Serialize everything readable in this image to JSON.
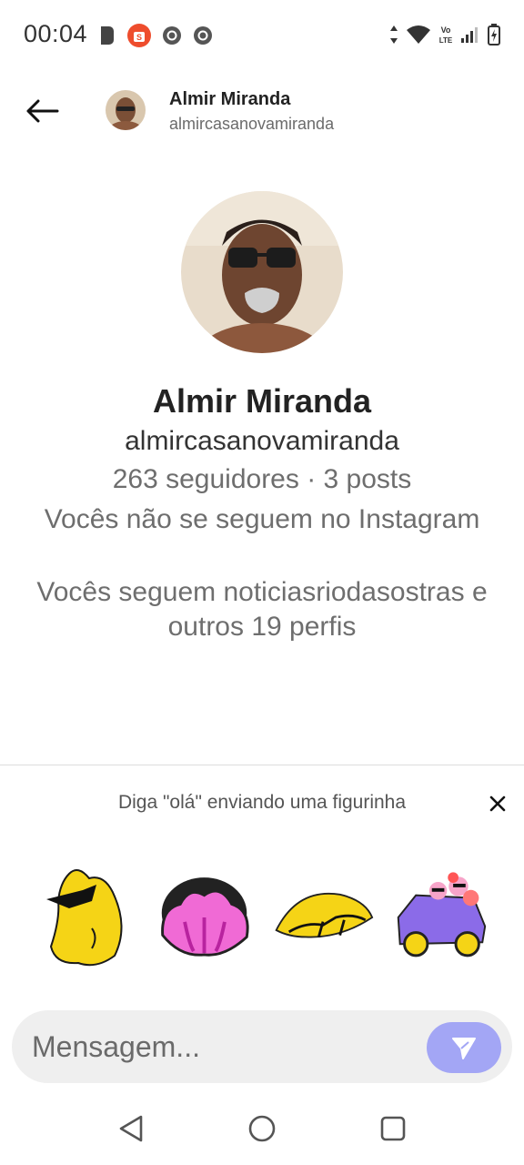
{
  "status_bar": {
    "time": "00:04",
    "left_icons": [
      "b-app-icon",
      "shopee-icon",
      "chrome-icon",
      "chrome-icon"
    ],
    "right_icons": [
      "data-arrows-icon",
      "wifi-icon",
      "volte-icon",
      "signal-icon",
      "battery-charging-icon"
    ],
    "volte_text": "Vo LTE"
  },
  "header": {
    "name": "Almir Miranda",
    "handle": "almircasanovamiranda"
  },
  "profile": {
    "name": "Almir Miranda",
    "handle": "almircasanovamiranda",
    "stats": "263 seguidores · 3 posts",
    "follow_status": "Vocês não se seguem no Instagram",
    "mutual": "Vocês seguem noticiasriodasostras e outros 19 perfis"
  },
  "stickers": {
    "prompt": "Diga \"olá\" enviando uma figurinha",
    "items": [
      "yellow-star-sunglasses-sticker",
      "pink-flower-sticker",
      "yellow-leaf-sticker",
      "purple-car-flowers-sticker"
    ]
  },
  "composer": {
    "placeholder": "Mensagem..."
  },
  "colors": {
    "send_button": "#a3a6f5",
    "divider": "#dcdcdc",
    "composer_bg": "#efefef"
  }
}
